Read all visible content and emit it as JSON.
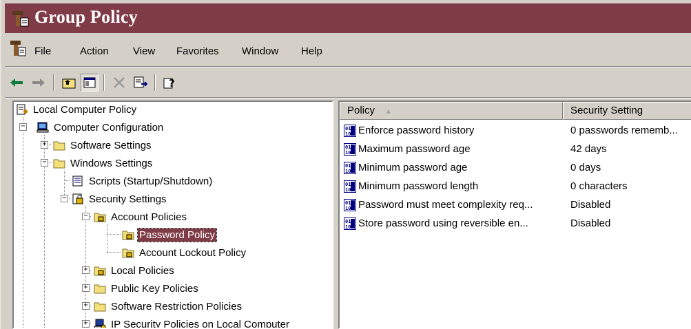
{
  "window": {
    "title": "Group Policy",
    "accent": "#7f3b46"
  },
  "menu": {
    "items": [
      {
        "label": "File"
      },
      {
        "label": "Action"
      },
      {
        "label": "View"
      },
      {
        "label": "Favorites"
      },
      {
        "label": "Window"
      },
      {
        "label": "Help"
      }
    ]
  },
  "toolbar": {
    "buttons": [
      "back-arrow-icon",
      "forward-arrow-icon",
      "up-one-level-icon",
      "show-hide-tree-icon",
      "delete-icon",
      "export-list-icon",
      "help-icon"
    ]
  },
  "tree": {
    "root": "Local Computer Policy",
    "computer_configuration": "Computer Configuration",
    "software_settings": "Software Settings",
    "windows_settings": "Windows Settings",
    "scripts": "Scripts (Startup/Shutdown)",
    "security_settings": "Security Settings",
    "account_policies": "Account Policies",
    "password_policy": "Password Policy",
    "account_lockout_policy": "Account Lockout Policy",
    "local_policies": "Local Policies",
    "public_key_policies": "Public Key Policies",
    "software_restriction_policies": "Software Restriction Policies",
    "ip_security_policies": "IP Security Policies on Local Computer"
  },
  "list": {
    "columns": {
      "policy": "Policy",
      "setting": "Security Setting"
    },
    "sort_indicator": "▲",
    "rows": [
      {
        "policy": "Enforce password history",
        "setting": "0 passwords rememb..."
      },
      {
        "policy": "Maximum password age",
        "setting": "42 days"
      },
      {
        "policy": "Minimum password age",
        "setting": "0 days"
      },
      {
        "policy": "Minimum password length",
        "setting": "0 characters"
      },
      {
        "policy": "Password must meet complexity req...",
        "setting": "Disabled"
      },
      {
        "policy": "Store password using reversible en...",
        "setting": "Disabled"
      }
    ]
  }
}
